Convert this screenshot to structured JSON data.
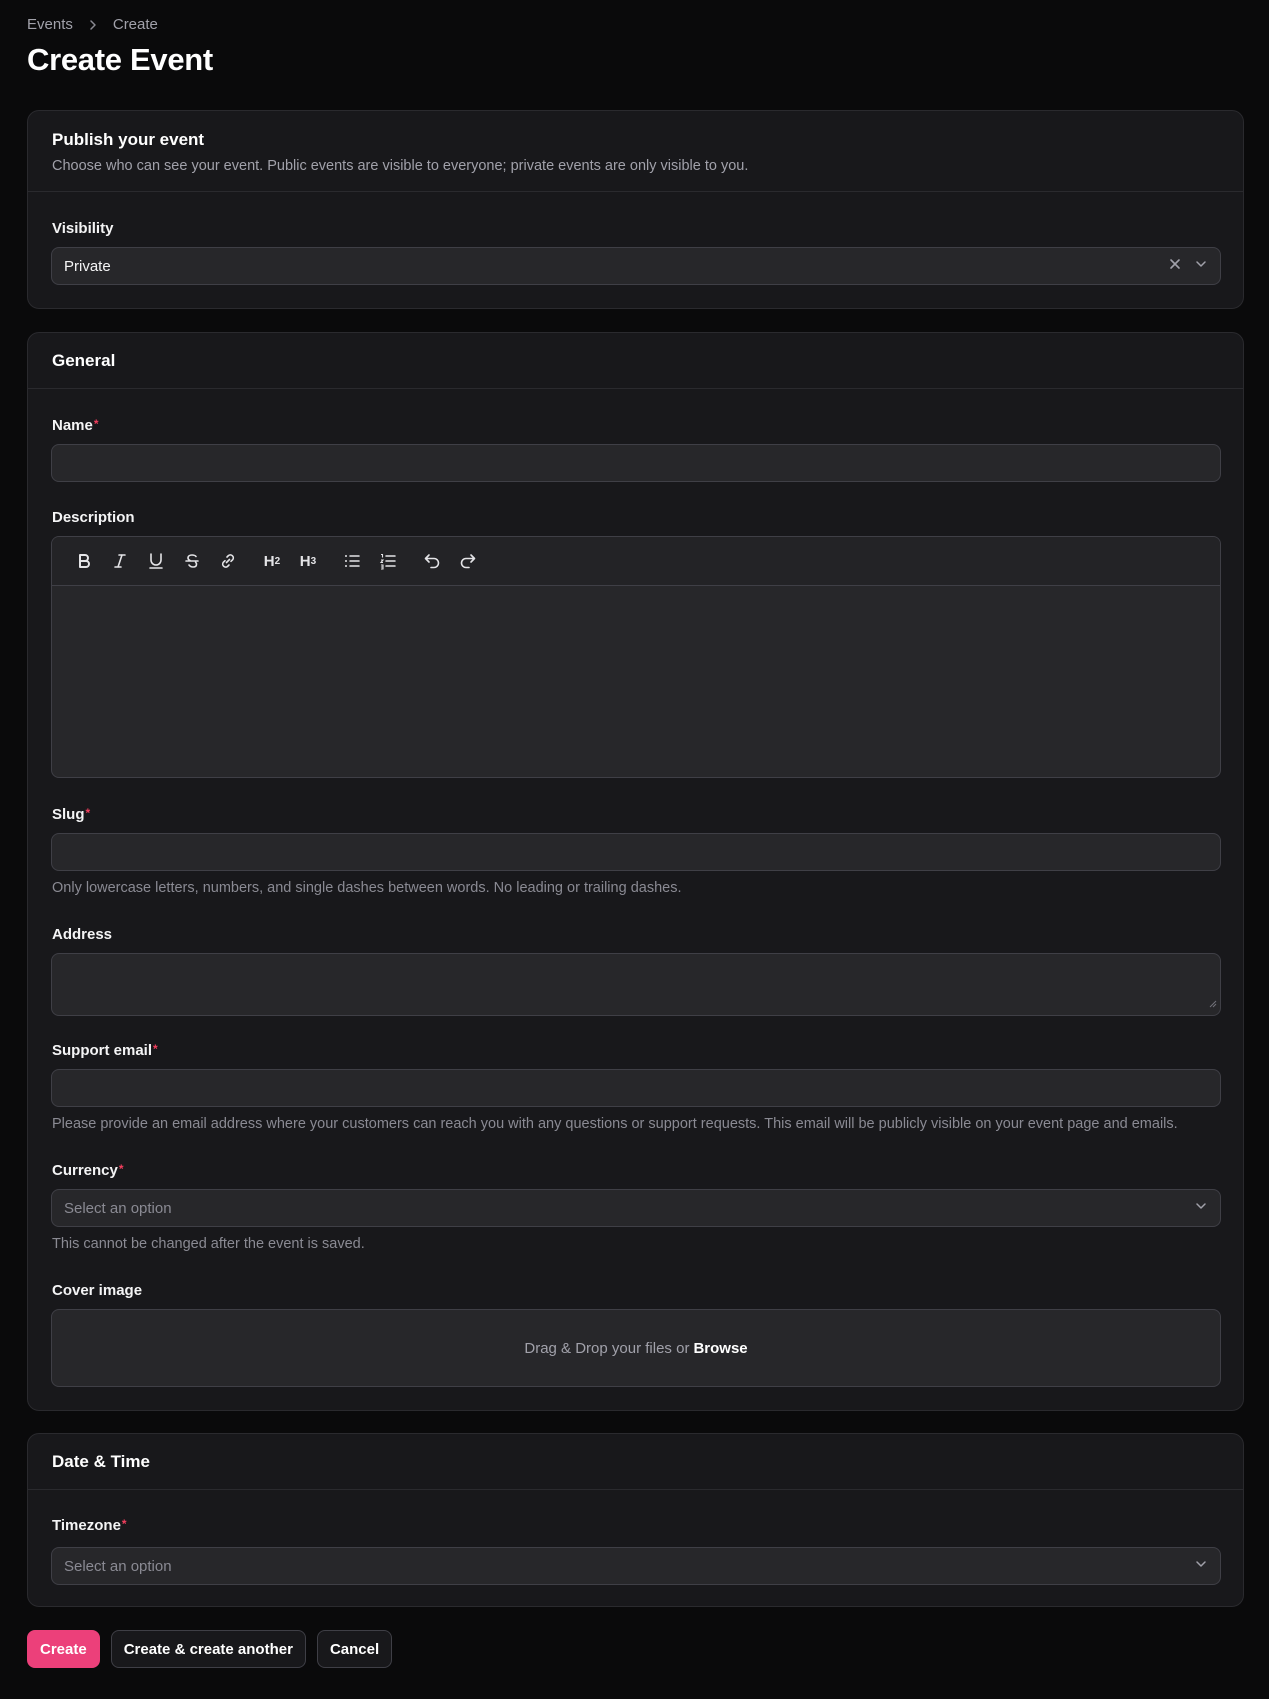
{
  "breadcrumb": {
    "parent": "Events",
    "current": "Create"
  },
  "page_title": "Create Event",
  "publish": {
    "title": "Publish your event",
    "description": "Choose who can see your event. Public events are visible to everyone; private events are only visible to you.",
    "visibility_label": "Visibility",
    "visibility_value": "Private"
  },
  "general": {
    "title": "General",
    "name_label": "Name",
    "description_label": "Description",
    "toolbar": [
      "bold",
      "italic",
      "underline",
      "strikethrough",
      "link",
      "h2",
      "h3",
      "bullet-list",
      "ordered-list",
      "undo",
      "redo"
    ],
    "toolbar_h2": "H",
    "toolbar_h2_sub": "2",
    "toolbar_h3": "H",
    "toolbar_h3_sub": "3",
    "slug_label": "Slug",
    "slug_hint": "Only lowercase letters, numbers, and single dashes between words. No leading or trailing dashes.",
    "address_label": "Address",
    "support_email_label": "Support email",
    "support_email_hint": "Please provide an email address where your customers can reach you with any questions or support requests. This email will be publicly visible on your event page and emails.",
    "currency_label": "Currency",
    "currency_placeholder": "Select an option",
    "currency_hint": "This cannot be changed after the event is saved.",
    "cover_label": "Cover image",
    "dropzone_text": "Drag & Drop your files or",
    "dropzone_browse": "Browse"
  },
  "datetime": {
    "title": "Date & Time",
    "timezone_label": "Timezone",
    "timezone_placeholder": "Select an option"
  },
  "required_mark": "*",
  "actions": {
    "create": "Create",
    "create_another": "Create & create another",
    "cancel": "Cancel"
  },
  "colors": {
    "accent": "#ec407a",
    "required": "#f43f5e",
    "background": "#0a0a0b",
    "card": "#18181b"
  }
}
